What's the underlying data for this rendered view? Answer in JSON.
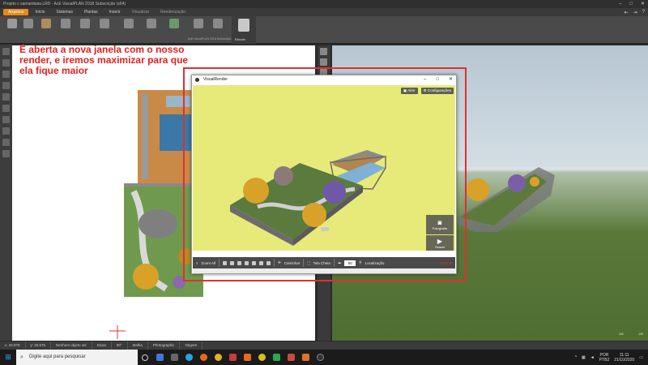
{
  "window": {
    "title": "Projeto c samambaia.LRD - AcE VisualPLAN 2018 Subscrição (x64)",
    "controls": [
      "–",
      "□",
      "✕"
    ]
  },
  "ribbon": {
    "tabs": [
      "Arquivos",
      "Início",
      "Sistemas",
      "Plantas",
      "Inserir",
      "Visualizar",
      "Renderização"
    ],
    "active_tab": "Visualizar",
    "render_label": "Render",
    "plugin_label": "AcE VisualPLAN 2018 Subscrição"
  },
  "annotation": {
    "text": "É aberta a nova janela com o nosso render, e iremos maximizar para que ela fique maior"
  },
  "visualrender": {
    "title": "VisualRender",
    "open_label": "Abrir",
    "settings_label": "Configurações",
    "photograph_label": "Fotografar",
    "record_label": "Gravar",
    "stop_label": "PARAR",
    "zoom_all_label": "Zoom All",
    "walk_label": "Caminhar",
    "fullscreen_label": "Tela Cheia",
    "cloud_value": "50",
    "location_label": "Localização"
  },
  "statusbar": {
    "x": "x: 26.978",
    "y": "y: 20.575",
    "selection": "Nenhum objeto sel",
    "tips": "Dicas",
    "angle": "90°",
    "grid": "Malha",
    "photographic": "Photographic",
    "origin": "Origem"
  },
  "view3d": {
    "coord_left": "0/1",
    "coord_right": "2/0"
  },
  "taskbar": {
    "search_placeholder": "Digite aqui para pesquisar",
    "lang": "POR",
    "lang2": "PTB2",
    "time": "11:11",
    "date": "21/10/2020"
  },
  "colors": {
    "accent": "#e88a1a",
    "annotation": "#e02020",
    "render_bg": "#e7ea78"
  }
}
